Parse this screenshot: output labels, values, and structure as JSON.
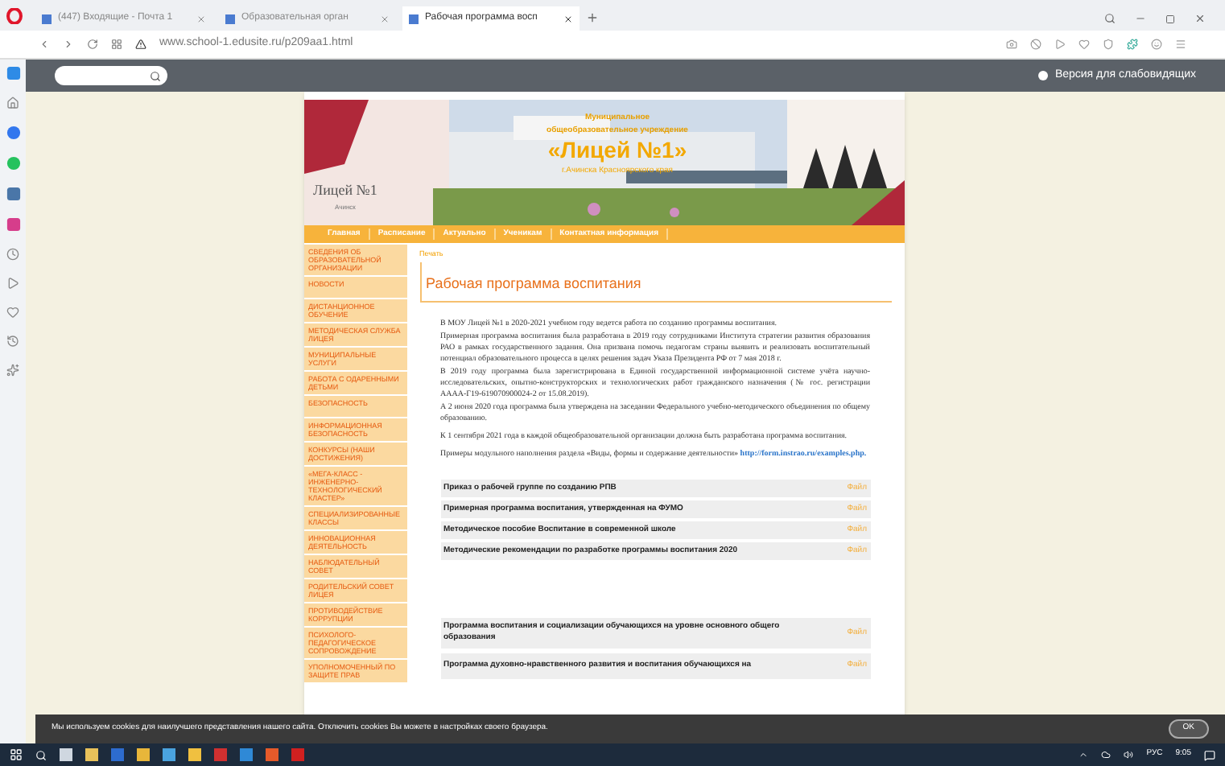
{
  "browser": {
    "tabs": [
      {
        "label": "(447) Входящие - Почта 1",
        "selected": false
      },
      {
        "label": "Образовательная орган",
        "selected": false
      },
      {
        "label": "Рабочая программа восп",
        "selected": true
      }
    ],
    "url": "www.school-1.edusite.ru/p209aa1.html"
  },
  "site_bar": {
    "accessibility_link": "Версия для слабовидящих"
  },
  "header": {
    "logo_title": "Лицей №1",
    "logo_city": "Ачинск",
    "line_1": "Муниципальное",
    "line_2": "общеобразовательное учреждение",
    "school_name": "«Лицей №1»",
    "city": "г.Ачинска Красноярского края"
  },
  "nav": [
    {
      "label": "Главная"
    },
    {
      "label": "Расписание"
    },
    {
      "label": "Актуально"
    },
    {
      "label": "Ученикам"
    },
    {
      "label": "Контактная информация"
    }
  ],
  "sidebar": {
    "items": [
      "СВЕДЕНИЯ ОБ ОБРАЗОВАТЕЛЬНОЙ ОРГАНИЗАЦИИ",
      "НОВОСТИ",
      "ДИСТАНЦИОННОЕ ОБУЧЕНИЕ",
      "МЕТОДИЧЕСКАЯ СЛУЖБА ЛИЦЕЯ",
      "МУНИЦИПАЛЬНЫЕ УСЛУГИ",
      "РАБОТА С ОДАРЕННЫМИ ДЕТЬМИ",
      "БЕЗОПАСНОСТЬ",
      "ИНФОРМАЦИОННАЯ БЕЗОПАСНОСТЬ",
      "КОНКУРСЫ (НАШИ ДОСТИЖЕНИЯ)",
      "«МЕГА-КЛАСС - ИНЖЕНЕРНО-ТЕХНОЛОГИЧЕСКИЙ КЛАСТЕР»",
      "СПЕЦИАЛИЗИРОВАННЫЕ КЛАССЫ",
      "ИННОВАЦИОННАЯ ДЕЯТЕЛЬНОСТЬ",
      "НАБЛЮДАТЕЛЬНЫЙ СОВЕТ",
      "РОДИТЕЛЬСКИЙ СОВЕТ ЛИЦЕЯ",
      "ПРОТИВОДЕЙСТВИЕ КОРРУПЦИИ",
      "ПСИХОЛОГО-ПЕДАГОГИЧЕСКОЕ СОПРОВОЖДЕНИЕ",
      "УПОЛНОМОЧЕННЫЙ ПО ЗАЩИТЕ ПРАВ"
    ]
  },
  "content": {
    "print_link": "Печать",
    "title": "Рабочая программа воспитания",
    "paragraphs": [
      "В МОУ Лицей №1 в 2020-2021 учебном году ведется работа по созданию программы воспитания.",
      "Примерная программа воспитания была разработана в 2019 году сотрудниками Института стратегии развития образования РАО в рамках государственного задания. Она призвана помочь педагогам страны выявить и реализовать воспитательный потенциал образовательного процесса в целях решения задач Указа Президента РФ от 7 мая 2018 г.",
      "В 2019 году программа была зарегистрирована в Единой государственной информационной системе учёта научно-исследовательских, опытно-конструкторских и технологических работ гражданского назначения (№ гос. регистрации АААА-Г19-619070900024-2 от 15.08.2019).",
      "А 2 июня 2020 года программа была утверждена на заседании Федерального учебно-методического объединения по общему образованию.",
      "К 1 сентября 2021 года в каждой общеобразовательной организации должна быть разработана программа воспитания."
    ],
    "examples_text": "Примеры модульного наполнения раздела «Виды, формы и содержание деятельности»",
    "examples_link": "http://form.instrao.ru/examples.php."
  },
  "files_1": [
    {
      "name": "Приказ о рабочей группе по созданию РПВ",
      "link": "Файл"
    },
    {
      "name": "Примерная программа воспитания, утвержденная на ФУМО",
      "link": "Файл"
    },
    {
      "name": "Методическое пособие Воспитание в современной школе",
      "link": "Файл"
    },
    {
      "name": "Методические рекомендации по разработке программы воспитания 2020",
      "link": "Файл"
    }
  ],
  "files_2": [
    {
      "name": "Программа воспитания и социализации обучающихся на уровне основного общего образования",
      "link": "Файл"
    },
    {
      "name": "Программа духовно-нравственного развития и воспитания обучающихся на",
      "link": "Файл"
    }
  ],
  "cookie_bar": {
    "text": "Мы используем cookies для наилучшего представления нашего сайта. Отключить cookies Вы можете в настройках своего браузера.",
    "button": "OK"
  },
  "taskbar": {
    "language": "РУС",
    "time": "9:05"
  }
}
